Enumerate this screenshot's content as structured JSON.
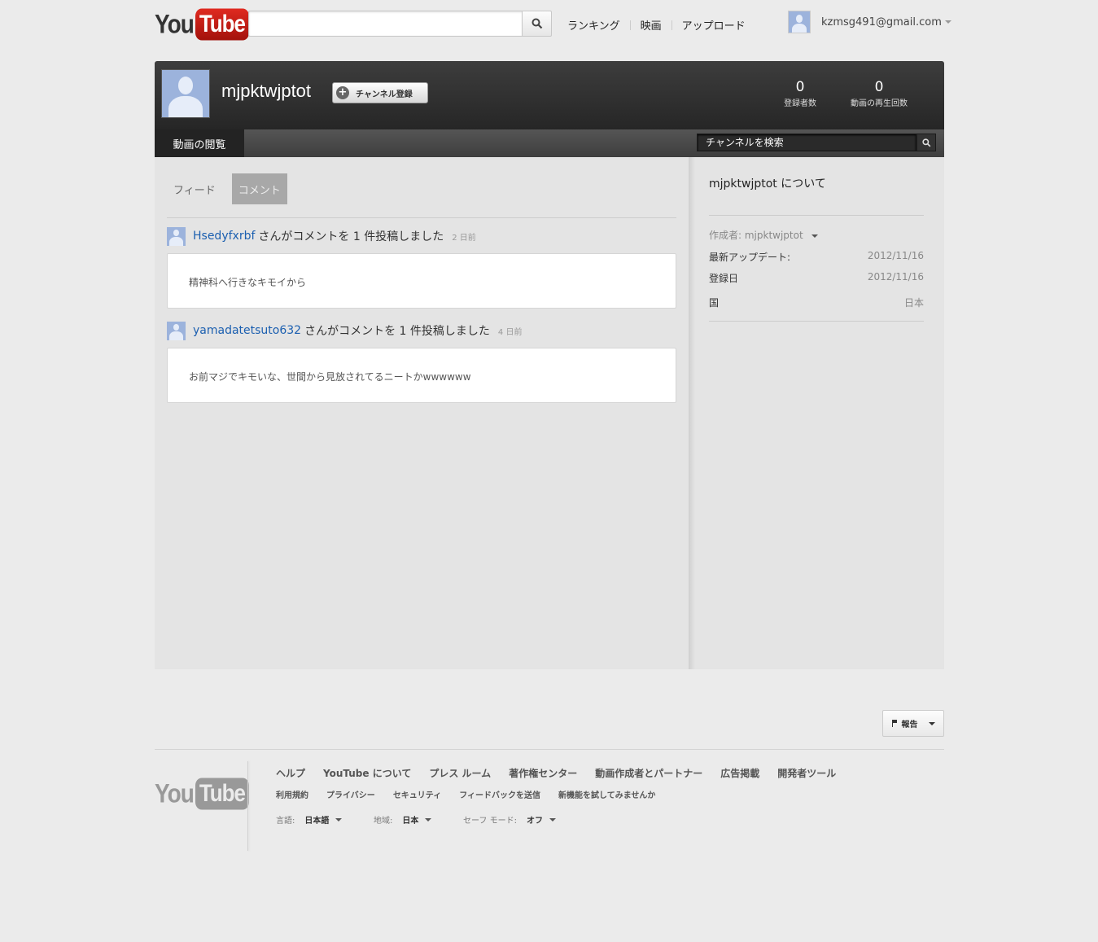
{
  "masthead": {
    "logo_you": "You",
    "logo_tube": "Tube",
    "search_value": "",
    "nav": [
      "ランキング",
      "映画",
      "アップロード"
    ],
    "account_email": "kzmsg491@gmail.com"
  },
  "channel": {
    "name": "mjpktwjptot",
    "subscribe_label": "チャンネル登録",
    "subscribers_count": "0",
    "subscribers_label": "登録者数",
    "views_count": "0",
    "views_label": "動画の再生回数",
    "nav_tab": "動画の閲覧",
    "search_placeholder": "チャンネルを検索"
  },
  "feed": {
    "tabs": [
      "フィード",
      "コメント"
    ],
    "active_tab": "コメント",
    "items": [
      {
        "user": "Hsedyfxrbf",
        "action": "さんがコメントを 1 件投稿しました",
        "time": "2 日前",
        "comment": "精神科へ行きなキモイから"
      },
      {
        "user": "yamadatetsuto632",
        "action": "さんがコメントを 1 件投稿しました",
        "time": "4 日前",
        "comment": "お前マジでキモいな、世間から見放されてるニートかwwwwww"
      }
    ]
  },
  "about": {
    "title": "mjpktwjptot について",
    "author": "作成者: mjpktwjptot",
    "rows": [
      {
        "key": "最新アップデート:",
        "value": "2012/11/16"
      },
      {
        "key": "登録日",
        "value": "2012/11/16"
      },
      {
        "key": "国",
        "value": "日本"
      }
    ]
  },
  "report_label": "報告",
  "footer": {
    "primary_links": [
      "ヘルプ",
      "YouTube について",
      "プレス ルーム",
      "著作権センター",
      "動画作成者とパートナー",
      "広告掲載",
      "開発者ツール"
    ],
    "secondary_links": [
      "利用規約",
      "プライバシー",
      "セキュリティ",
      "フィードバックを送信",
      "新機能を試してみませんか"
    ],
    "language_label": "言語:",
    "language_value": "日本語",
    "region_label": "地域:",
    "region_value": "日本",
    "safety_label": "セーフ モード:",
    "safety_value": "オフ"
  }
}
